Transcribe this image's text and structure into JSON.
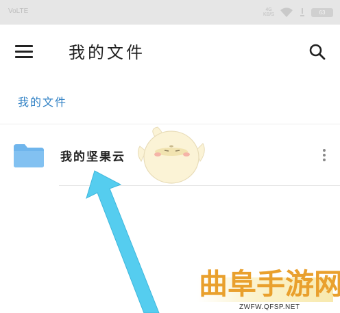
{
  "status_bar": {
    "carrier": "VoLTE",
    "network_top": "4G",
    "network_bottom": "KB/S",
    "battery": "63"
  },
  "app_bar": {
    "menu_icon": "hamburger-menu-icon",
    "title": "我的文件",
    "search_icon": "search-icon"
  },
  "breadcrumb": {
    "label": "我的文件"
  },
  "file_list": {
    "items": [
      {
        "name": "我的坚果云",
        "icon": "folder-icon",
        "more_icon": "more-vertical-icon"
      }
    ]
  },
  "watermark": {
    "text": "曲阜手游网",
    "url": "ZWFW.QFSP.NET"
  },
  "colors": {
    "status_bar_bg": "#e6e6e6",
    "breadcrumb": "#2f80c4",
    "folder": "#6fb5ec",
    "arrow": "#55cdef",
    "watermark": "#e9a02d"
  }
}
